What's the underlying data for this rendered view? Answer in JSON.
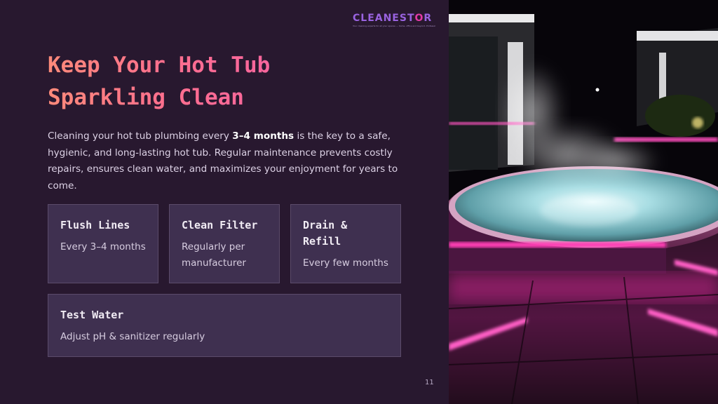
{
  "brand": {
    "name_part1": "CLEANEST",
    "name_o": "O",
    "name_part2": "R",
    "tagline": "Your cleaning experts for all your spaces — home, office and beyond. Professional Cleaning Services",
    "colors": {
      "primary": "#9a63e0",
      "accent": "#e23aa5"
    }
  },
  "slide": {
    "title_line1": "Keep Your Hot Tub",
    "title_line2": "Sparkling Clean",
    "intro_before": "Cleaning your hot tub plumbing every ",
    "intro_bold": "3–4 months",
    "intro_after": " is the key to a safe, hygienic, and long-lasting hot tub. Regular maintenance prevents costly repairs, ensures clean water, and maximizes your enjoyment for years to come.",
    "page_number": "11"
  },
  "cards": [
    {
      "title": "Flush Lines",
      "desc": "Every 3–4 months"
    },
    {
      "title": "Clean Filter",
      "desc": "Regularly per manufacturer"
    },
    {
      "title": "Drain & Refill",
      "desc": "Every few months"
    },
    {
      "title": "Test Water",
      "desc": "Adjust pH & sanitizer regularly"
    }
  ],
  "colors": {
    "background": "#28182f",
    "card": "#3f3050",
    "card_border": "#5b4b6a",
    "title_gradient": [
      "#ff8a7a",
      "#f35fa8"
    ],
    "led": "#ff3fb5"
  }
}
